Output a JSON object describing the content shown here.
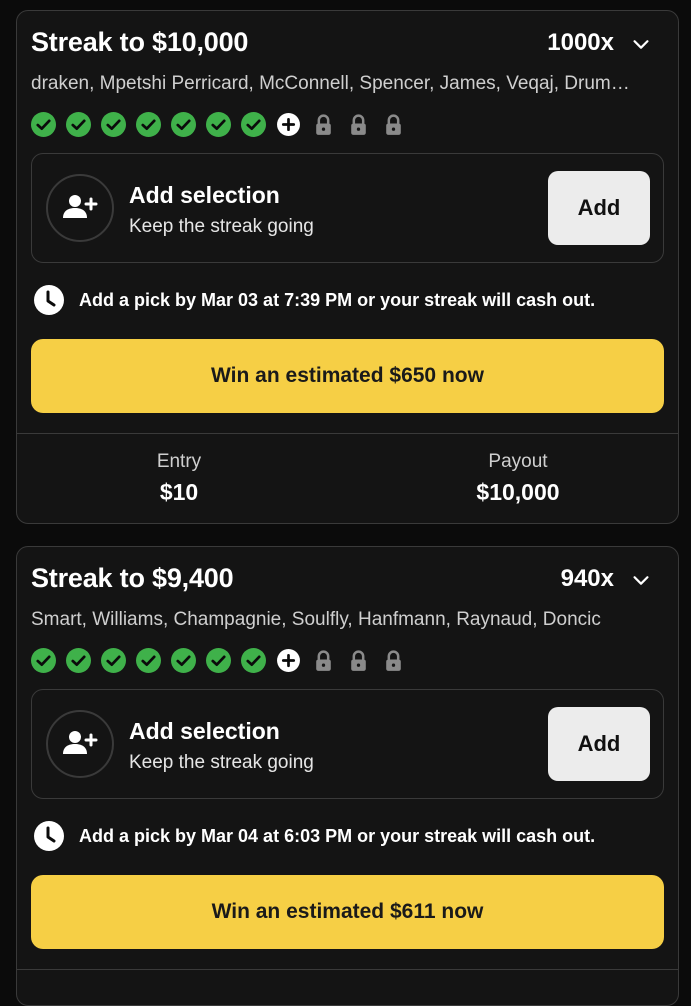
{
  "streaks": [
    {
      "title": "Streak to $10,000",
      "multiplier": "1000x",
      "players": "draken, Mpetshi Perricard, McConnell, Spencer, James, Veqaj, Drum…",
      "progress": {
        "completed": 7,
        "total_shown": 11
      },
      "selection": {
        "title": "Add selection",
        "subtitle": "Keep the streak going",
        "button": "Add"
      },
      "deadline": "Add a pick by Mar 03 at 7:39 PM or your streak will cash out.",
      "cta": "Win an estimated $650 now",
      "entry_label": "Entry",
      "entry_value": "$10",
      "payout_label": "Payout",
      "payout_value": "$10,000"
    },
    {
      "title": "Streak to $9,400",
      "multiplier": "940x",
      "players": "Smart, Williams, Champagnie, Soulfly, Hanfmann, Raynaud, Doncic",
      "progress": {
        "completed": 7,
        "total_shown": 11
      },
      "selection": {
        "title": "Add selection",
        "subtitle": "Keep the streak going",
        "button": "Add"
      },
      "deadline": "Add a pick by Mar 04 at 6:03 PM or your streak will cash out.",
      "cta": "Win an estimated $611 now"
    }
  ],
  "colors": {
    "check": "#3fb14a",
    "cta": "#f6cf45",
    "add_button": "#ececec",
    "lock": "#8a8a8a"
  },
  "icons": {
    "completed": "check-circle-icon",
    "next": "plus-circle-icon",
    "locked": "lock-icon",
    "clock": "clock-icon",
    "add_user": "add-user-icon",
    "expand": "chevron-down-icon"
  }
}
